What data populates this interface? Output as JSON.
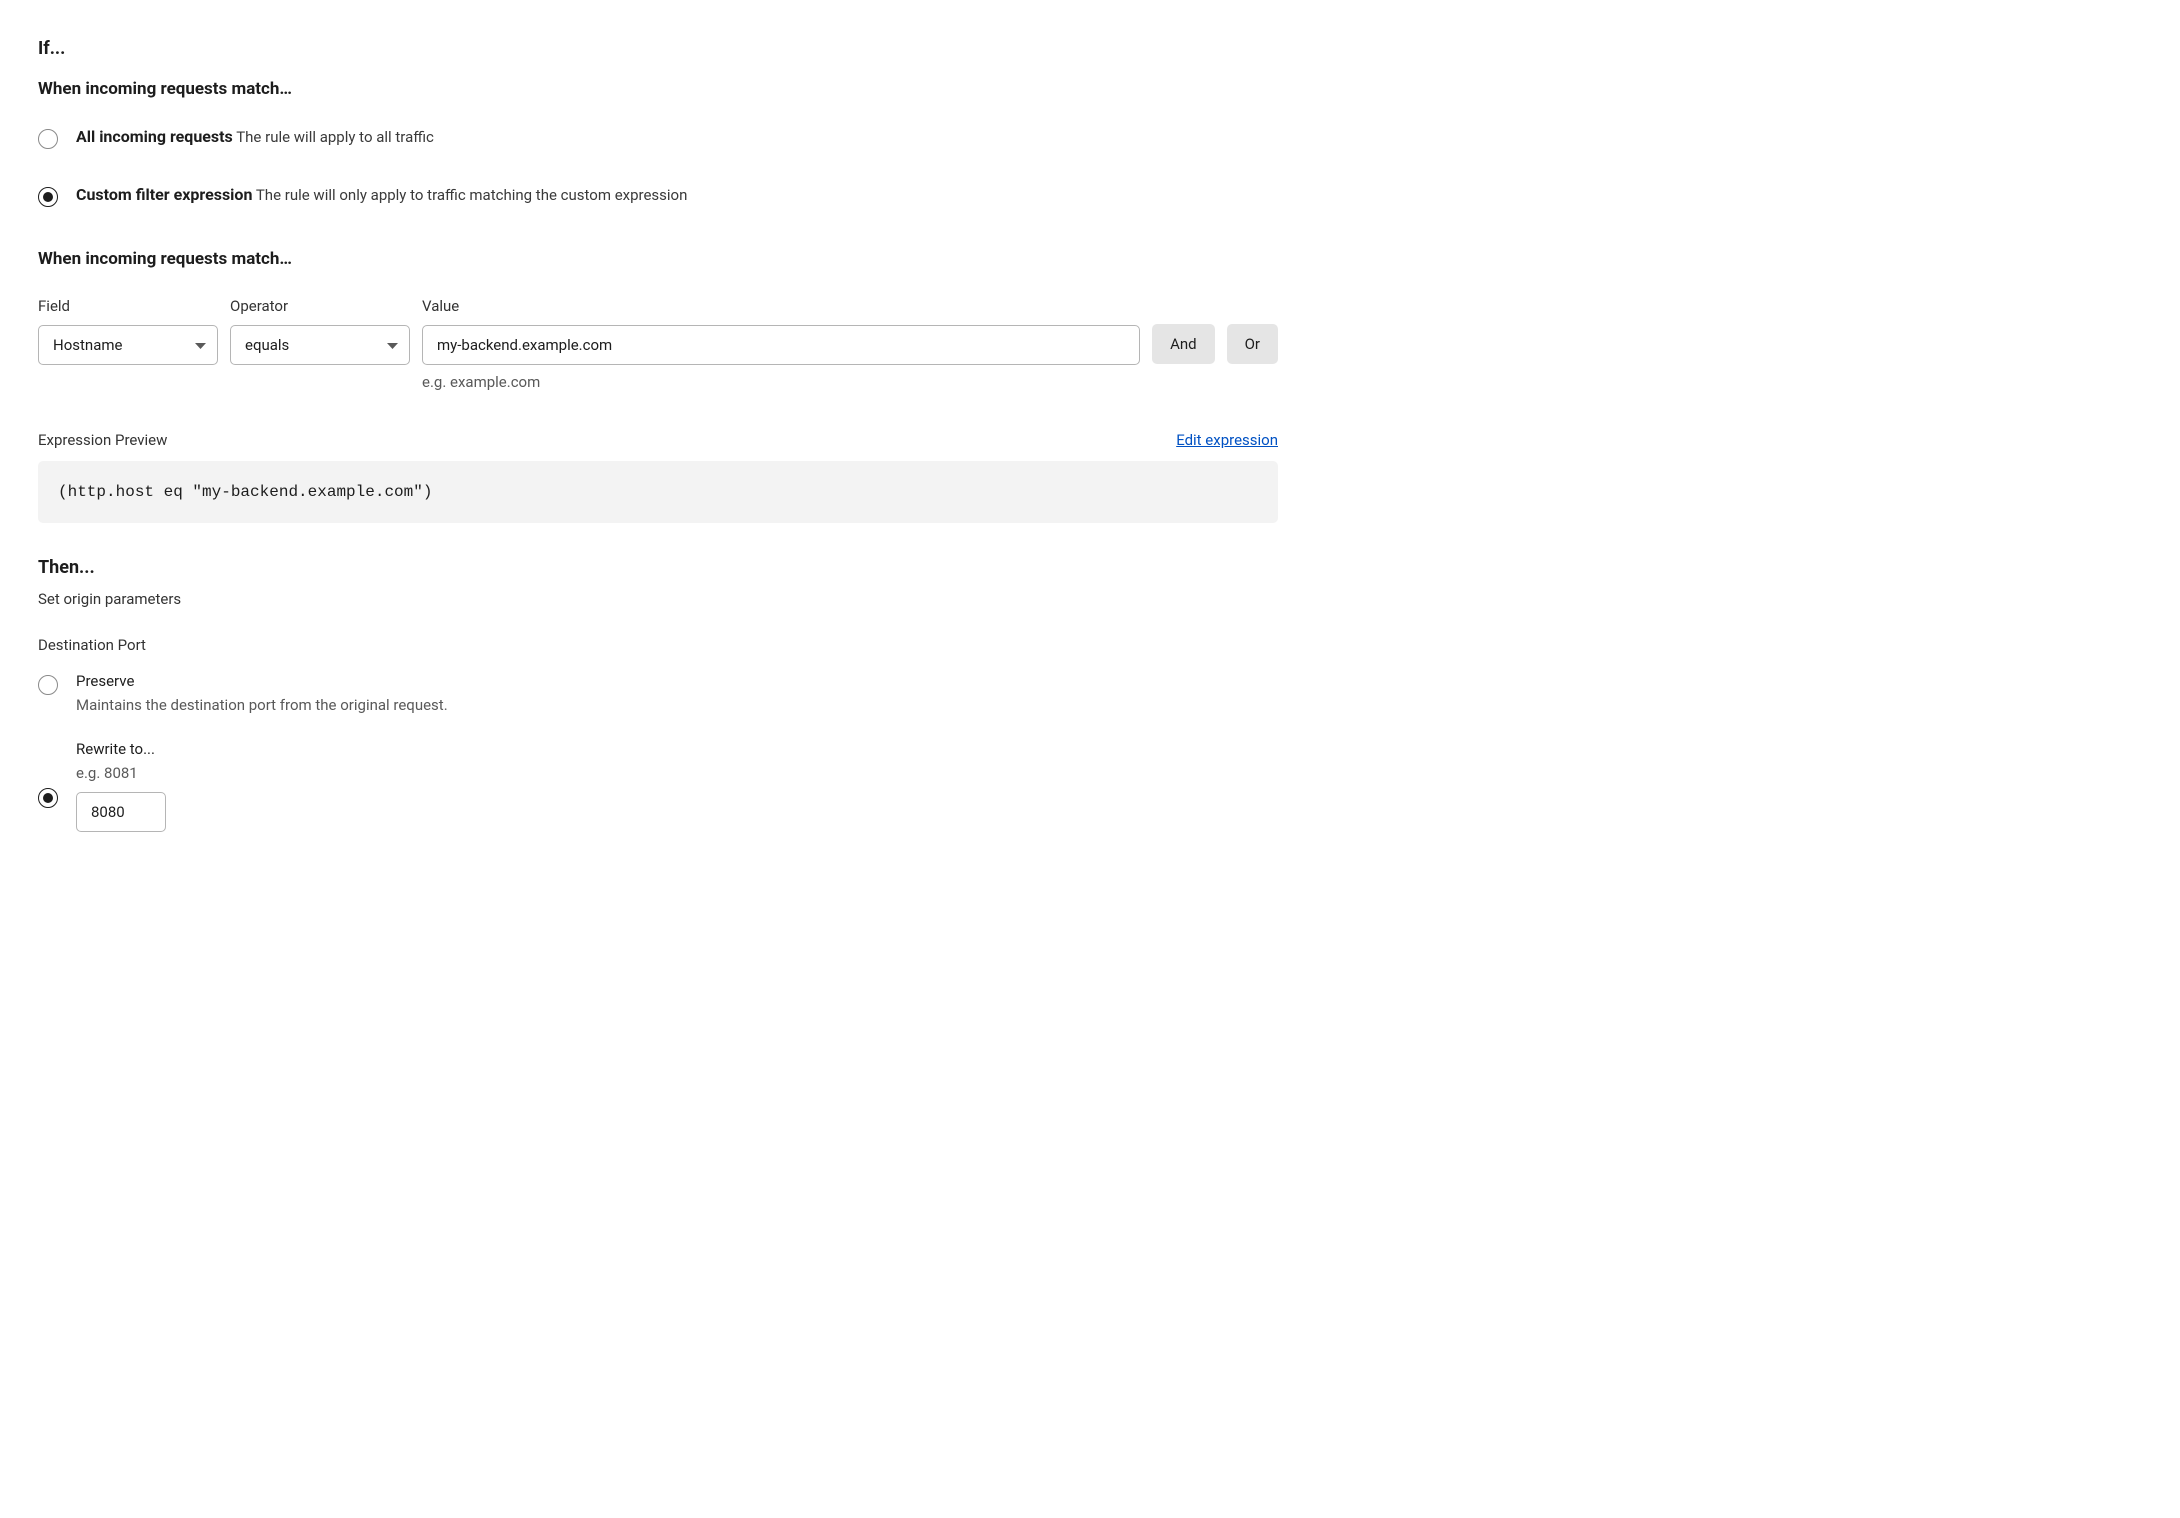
{
  "if_section": {
    "heading": "If...",
    "sub_heading": "When incoming requests match…",
    "options": {
      "all": {
        "title": "All incoming requests",
        "desc": "The rule will apply to all traffic"
      },
      "custom": {
        "title": "Custom filter expression",
        "desc": "The rule will only apply to traffic matching the custom expression"
      }
    }
  },
  "match_builder": {
    "heading": "When incoming requests match…",
    "labels": {
      "field": "Field",
      "operator": "Operator",
      "value": "Value"
    },
    "field_value": "Hostname",
    "operator_value": "equals",
    "value_input": "my-backend.example.com",
    "value_hint": "e.g. example.com",
    "and_label": "And",
    "or_label": "Or"
  },
  "preview": {
    "label": "Expression Preview",
    "edit_link": "Edit expression",
    "code": "(http.host eq \"my-backend.example.com\")"
  },
  "then_section": {
    "heading": "Then...",
    "subtitle": "Set origin parameters",
    "dest_port_label": "Destination Port",
    "preserve": {
      "title": "Preserve",
      "desc": "Maintains the destination port from the original request."
    },
    "rewrite": {
      "title": "Rewrite to...",
      "hint": "e.g. 8081",
      "value": "8080"
    }
  }
}
